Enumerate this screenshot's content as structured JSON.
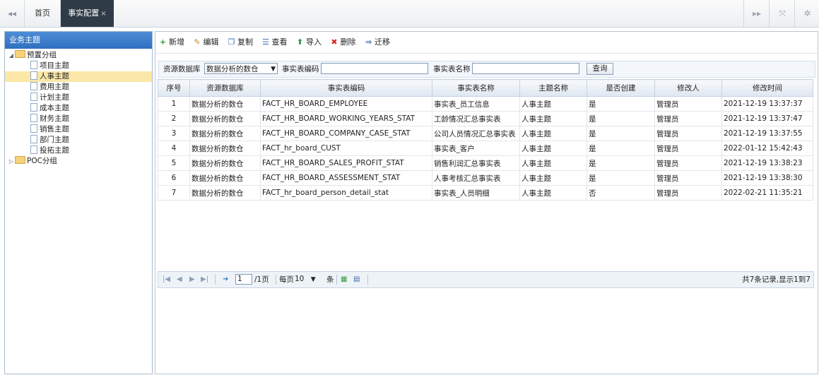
{
  "topbar": {
    "nav_left_icon": "double-left-arrow-icon",
    "tabs": [
      {
        "label": "首页"
      },
      {
        "label": "事实配置",
        "close": "×"
      }
    ],
    "right_icons": [
      "double-right-arrow-icon",
      "fullscreen-icon",
      "settings-icon"
    ]
  },
  "left_panel": {
    "title": "业务主题",
    "tree": {
      "group1": "预置分组",
      "items": [
        "项目主题",
        "人事主题",
        "费用主题",
        "计划主题",
        "成本主题",
        "财务主题",
        "销售主题",
        "部门主题",
        "投拓主题"
      ],
      "selected": "人事主题",
      "group2": "POC分组"
    }
  },
  "toolbar": {
    "new": "新增",
    "edit": "编辑",
    "copy": "复制",
    "view": "查看",
    "import": "导入",
    "delete": "删除",
    "migrate": "迁移"
  },
  "search": {
    "db_label": "资源数据库",
    "db_value": "数据分析的数仓",
    "code_label": "事实表编码",
    "name_label": "事实表名称",
    "query_button": "查询"
  },
  "grid": {
    "headers": [
      "序号",
      "资源数据库",
      "事实表编码",
      "事实表名称",
      "主题名称",
      "是否创建",
      "修改人",
      "修改时间"
    ],
    "rows": [
      [
        "1",
        "数据分析的数仓",
        "FACT_HR_BOARD_EMPLOYEE",
        "事实表_员工信息",
        "人事主题",
        "是",
        "管理员",
        "2021-12-19 13:37:37"
      ],
      [
        "2",
        "数据分析的数仓",
        "FACT_HR_BOARD_WORKING_YEARS_STAT",
        "工龄情况汇总事实表",
        "人事主题",
        "是",
        "管理员",
        "2021-12-19 13:37:47"
      ],
      [
        "3",
        "数据分析的数仓",
        "FACT_HR_BOARD_COMPANY_CASE_STAT",
        "公司人员情况汇总事实表",
        "人事主题",
        "是",
        "管理员",
        "2021-12-19 13:37:55"
      ],
      [
        "4",
        "数据分析的数仓",
        "FACT_hr_board_CUST",
        "事实表_客户",
        "人事主题",
        "是",
        "管理员",
        "2022-01-12 15:42:43"
      ],
      [
        "5",
        "数据分析的数仓",
        "FACT_HR_BOARD_SALES_PROFIT_STAT",
        "销售利润汇总事实表",
        "人事主题",
        "是",
        "管理员",
        "2021-12-19 13:38:23"
      ],
      [
        "6",
        "数据分析的数仓",
        "FACT_HR_BOARD_ASSESSMENT_STAT",
        "人事考核汇总事实表",
        "人事主题",
        "是",
        "管理员",
        "2021-12-19 13:38:30"
      ],
      [
        "7",
        "数据分析的数仓",
        "FACT_hr_board_person_detail_stat",
        "事实表_人员明细",
        "人事主题",
        "否",
        "管理员",
        "2022-02-21 11:35:21"
      ]
    ]
  },
  "pager": {
    "page": "1",
    "total_pages": "/1页",
    "per_page_label": "每页",
    "per_page": "10",
    "per_page_unit": "条",
    "info": "共7条记录,显示1到7"
  }
}
